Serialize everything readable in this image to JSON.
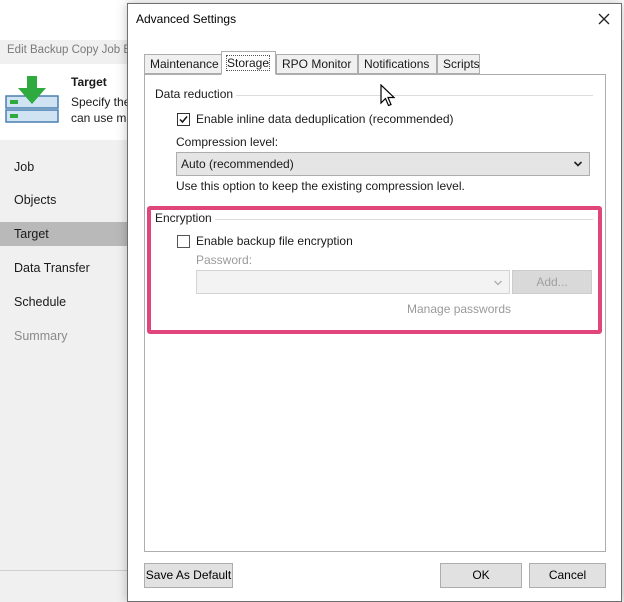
{
  "background_window": {
    "title": "Edit Backup Copy Job E",
    "header": {
      "title": "Target",
      "description_line1": "Specify the",
      "description_line2": "can use ma"
    },
    "nav": [
      {
        "label": "Job",
        "state": "normal"
      },
      {
        "label": "Objects",
        "state": "normal"
      },
      {
        "label": "Target",
        "state": "active"
      },
      {
        "label": "Data Transfer",
        "state": "normal"
      },
      {
        "label": "Schedule",
        "state": "normal"
      },
      {
        "label": "Summary",
        "state": "disabled"
      }
    ]
  },
  "dialog": {
    "title": "Advanced Settings",
    "close_icon": "close-icon",
    "tabs": [
      {
        "label": "Maintenance",
        "active": false
      },
      {
        "label": "Storage",
        "active": true
      },
      {
        "label": "RPO Monitor",
        "active": false
      },
      {
        "label": "Notifications",
        "active": false
      },
      {
        "label": "Scripts",
        "active": false
      }
    ],
    "data_reduction": {
      "group_label": "Data reduction",
      "dedup_label": "Enable inline data deduplication (recommended)",
      "dedup_checked": true,
      "compression_label": "Compression level:",
      "compression_value": "Auto (recommended)",
      "compression_hint": "Use this option to keep the existing compression level."
    },
    "encryption": {
      "group_label": "Encryption",
      "enable_label": "Enable backup file encryption",
      "enable_checked": false,
      "password_label": "Password:",
      "password_value": "",
      "add_button": "Add...",
      "manage_passwords": "Manage passwords"
    },
    "footer": {
      "save_default": "Save As Default",
      "ok": "OK",
      "cancel": "Cancel"
    }
  },
  "colors": {
    "highlight": "#e0457b",
    "active_nav": "#b9b9b9",
    "green_arrow": "#2eaa3f"
  }
}
